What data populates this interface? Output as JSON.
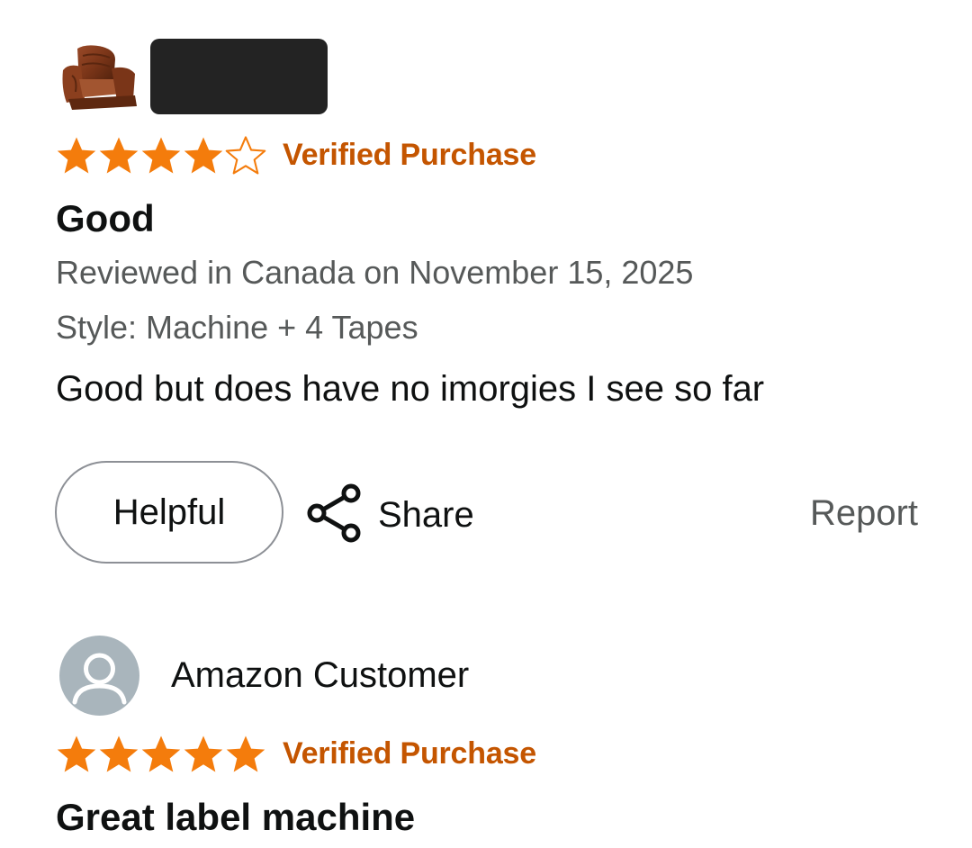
{
  "colors": {
    "star": "#F47C0C",
    "verified": "#C45500",
    "muted_text": "#565959",
    "avatar_bg": "#A9B5BC"
  },
  "review1": {
    "product_image": "recliner-chair-image",
    "stars": 4,
    "max_stars": 5,
    "verified_label": "Verified Purchase",
    "title": "Good",
    "reviewed_line": "Reviewed in Canada on November 15, 2025",
    "style_line": "Style: Machine + 4 Tapes",
    "body": "Good but does have no imorgies I see so far",
    "actions": {
      "helpful_label": "Helpful",
      "share_label": "Share",
      "share_icon": "share-icon",
      "report_label": "Report"
    }
  },
  "review2": {
    "avatar_icon": "person-icon",
    "author": "Amazon Customer",
    "stars": 5,
    "max_stars": 5,
    "verified_label": "Verified Purchase",
    "title": "Great label machine"
  }
}
